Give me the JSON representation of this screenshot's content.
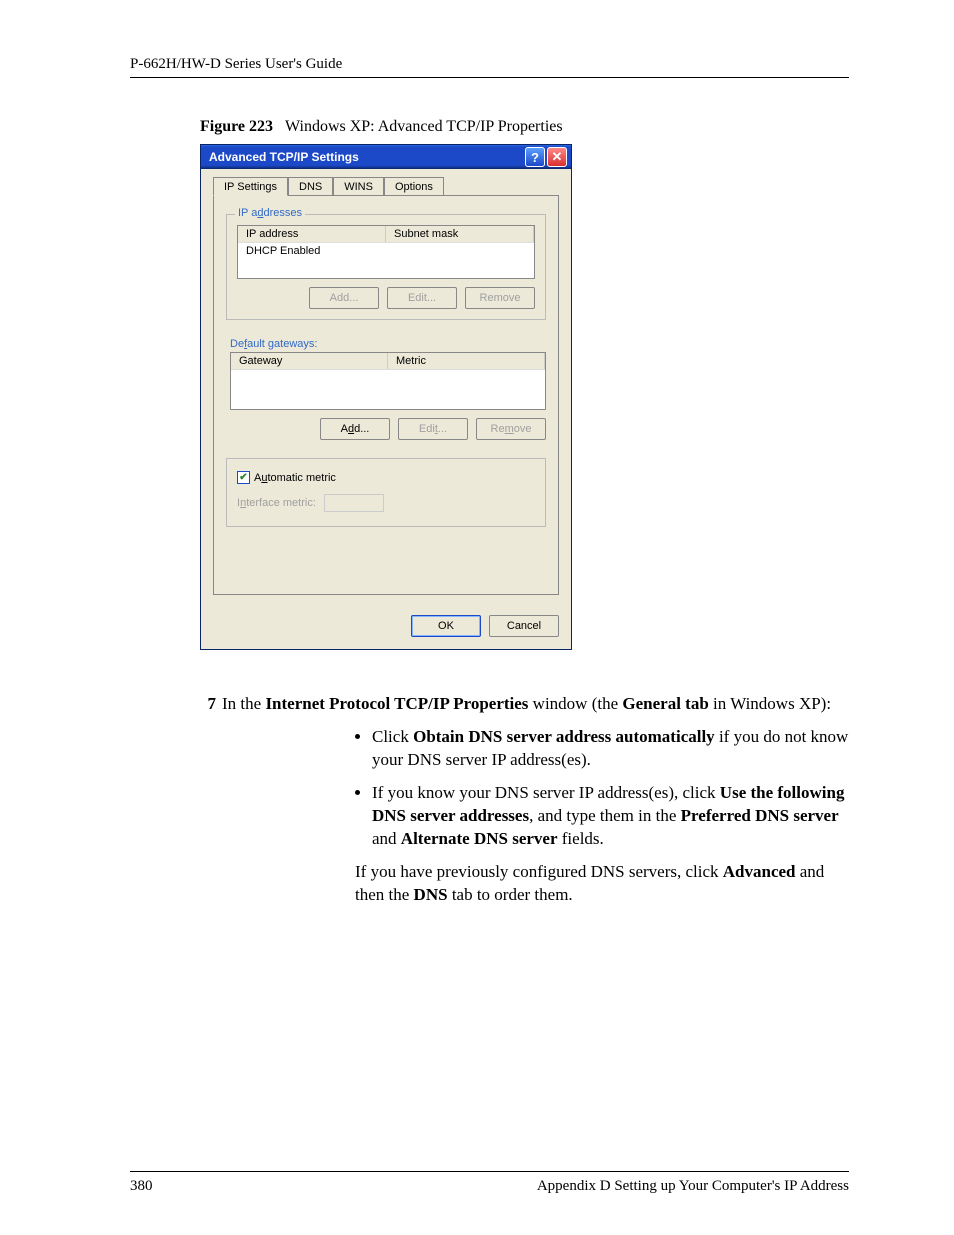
{
  "header": "P-662H/HW-D Series User's Guide",
  "figure": {
    "num": "Figure 223",
    "caption": "Windows XP: Advanced TCP/IP Properties"
  },
  "dialog": {
    "title": "Advanced TCP/IP Settings",
    "tabs": {
      "ip": "IP Settings",
      "dns": "DNS",
      "wins": "WINS",
      "options": "Options"
    },
    "group_ip": {
      "legend": "IP addresses",
      "col1": "IP address",
      "col2": "Subnet mask",
      "row1": "DHCP Enabled",
      "add": "Add...",
      "edit": "Edit...",
      "remove": "Remove"
    },
    "group_gw": {
      "legend": "Default gateways:",
      "col1": "Gateway",
      "col2": "Metric",
      "add": "Add...",
      "edit": "Edit...",
      "remove": "Remove"
    },
    "auto_metric": "Automatic metric",
    "interface_metric": "Interface metric:",
    "ok": "OK",
    "cancel": "Cancel"
  },
  "step7": {
    "num": "7",
    "pre": "In the ",
    "b1": "Internet Protocol TCP/IP Properties",
    "mid1": " window (the ",
    "b2": "General tab",
    "post": " in Windows XP):"
  },
  "bullet1": {
    "pre": "Click ",
    "b1": "Obtain DNS server address automatically",
    "post": " if you do not know your DNS server IP address(es)."
  },
  "bullet2": {
    "pre": "If you know your DNS server IP address(es), click ",
    "b1": "Use the following DNS server addresses",
    "mid1": ", and type them in the ",
    "b2": "Preferred DNS server",
    "mid2": " and ",
    "b3": "Alternate DNS server",
    "post": " fields."
  },
  "followpara": {
    "pre": "If you have previously configured DNS servers, click ",
    "b1": "Advanced",
    "mid": " and then the ",
    "b2": "DNS",
    "post": " tab to order them."
  },
  "footer": {
    "page": "380",
    "section": "Appendix D Setting up Your Computer's IP Address"
  }
}
